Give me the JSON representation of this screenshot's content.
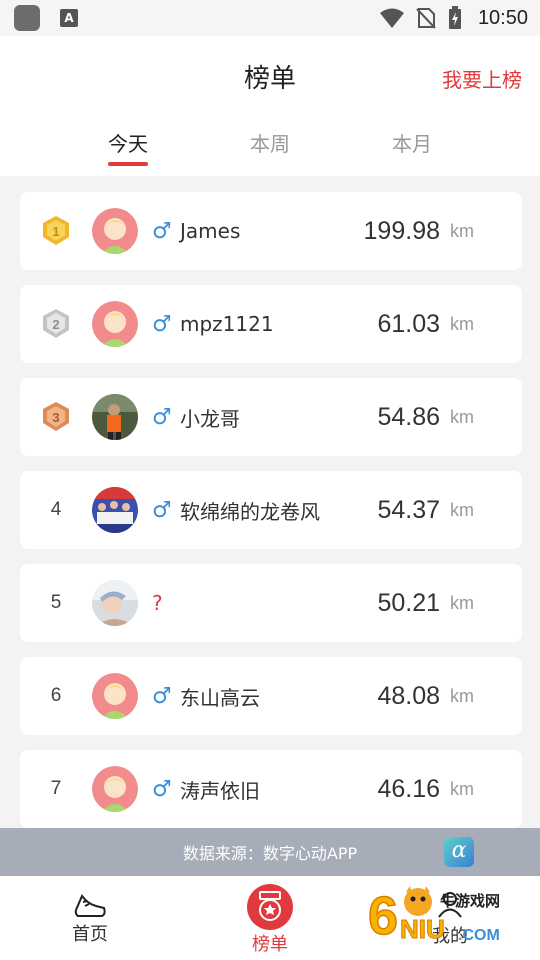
{
  "status_bar": {
    "time": "10:50",
    "app_icon_letter": "A"
  },
  "header": {
    "title": "榜单",
    "action_label": "我要上榜"
  },
  "tabs": [
    {
      "label": "今天",
      "active": true
    },
    {
      "label": "本周",
      "active": false
    },
    {
      "label": "本月",
      "active": false
    }
  ],
  "leaderboard": [
    {
      "rank": "1",
      "medal": "gold",
      "gender": "♂",
      "name": "James",
      "distance": "199.98",
      "unit": "km",
      "avatar": "default"
    },
    {
      "rank": "2",
      "medal": "silver",
      "gender": "♂",
      "name": "mpz1121",
      "distance": "61.03",
      "unit": "km",
      "avatar": "default"
    },
    {
      "rank": "3",
      "medal": "bronze",
      "gender": "♂",
      "name": "小龙哥",
      "distance": "54.86",
      "unit": "km",
      "avatar": "photo-runner"
    },
    {
      "rank": "4",
      "medal": "",
      "gender": "♂",
      "name": "软绵绵的龙卷风",
      "distance": "54.37",
      "unit": "km",
      "avatar": "photo-group"
    },
    {
      "rank": "5",
      "medal": "",
      "gender": "?",
      "name": "",
      "distance": "50.21",
      "unit": "km",
      "avatar": "photo-child"
    },
    {
      "rank": "6",
      "medal": "",
      "gender": "♂",
      "name": "东山高云",
      "distance": "48.08",
      "unit": "km",
      "avatar": "default"
    },
    {
      "rank": "7",
      "medal": "",
      "gender": "♂",
      "name": "涛声依旧",
      "distance": "46.16",
      "unit": "km",
      "avatar": "default"
    }
  ],
  "source_banner": {
    "text": "数据来源：数字心动APP",
    "logo_glyph": "α"
  },
  "bottom_nav": [
    {
      "label": "首页",
      "icon": "running-shoe-icon",
      "active": false
    },
    {
      "label": "榜单",
      "icon": "medal-icon",
      "active": true
    },
    {
      "label": "我的",
      "icon": "user-icon",
      "active": false
    }
  ],
  "watermark": {
    "brand_text": "牛游戏网",
    "digit": "6",
    "letters": "NIU",
    "domain": ".COM"
  },
  "colors": {
    "accent": "#e03a3e",
    "male": "#3a8fd8",
    "gold": "#f3b52a",
    "silver": "#c4c4c4",
    "bronze": "#e08a58",
    "banner": "#a6acb8"
  }
}
